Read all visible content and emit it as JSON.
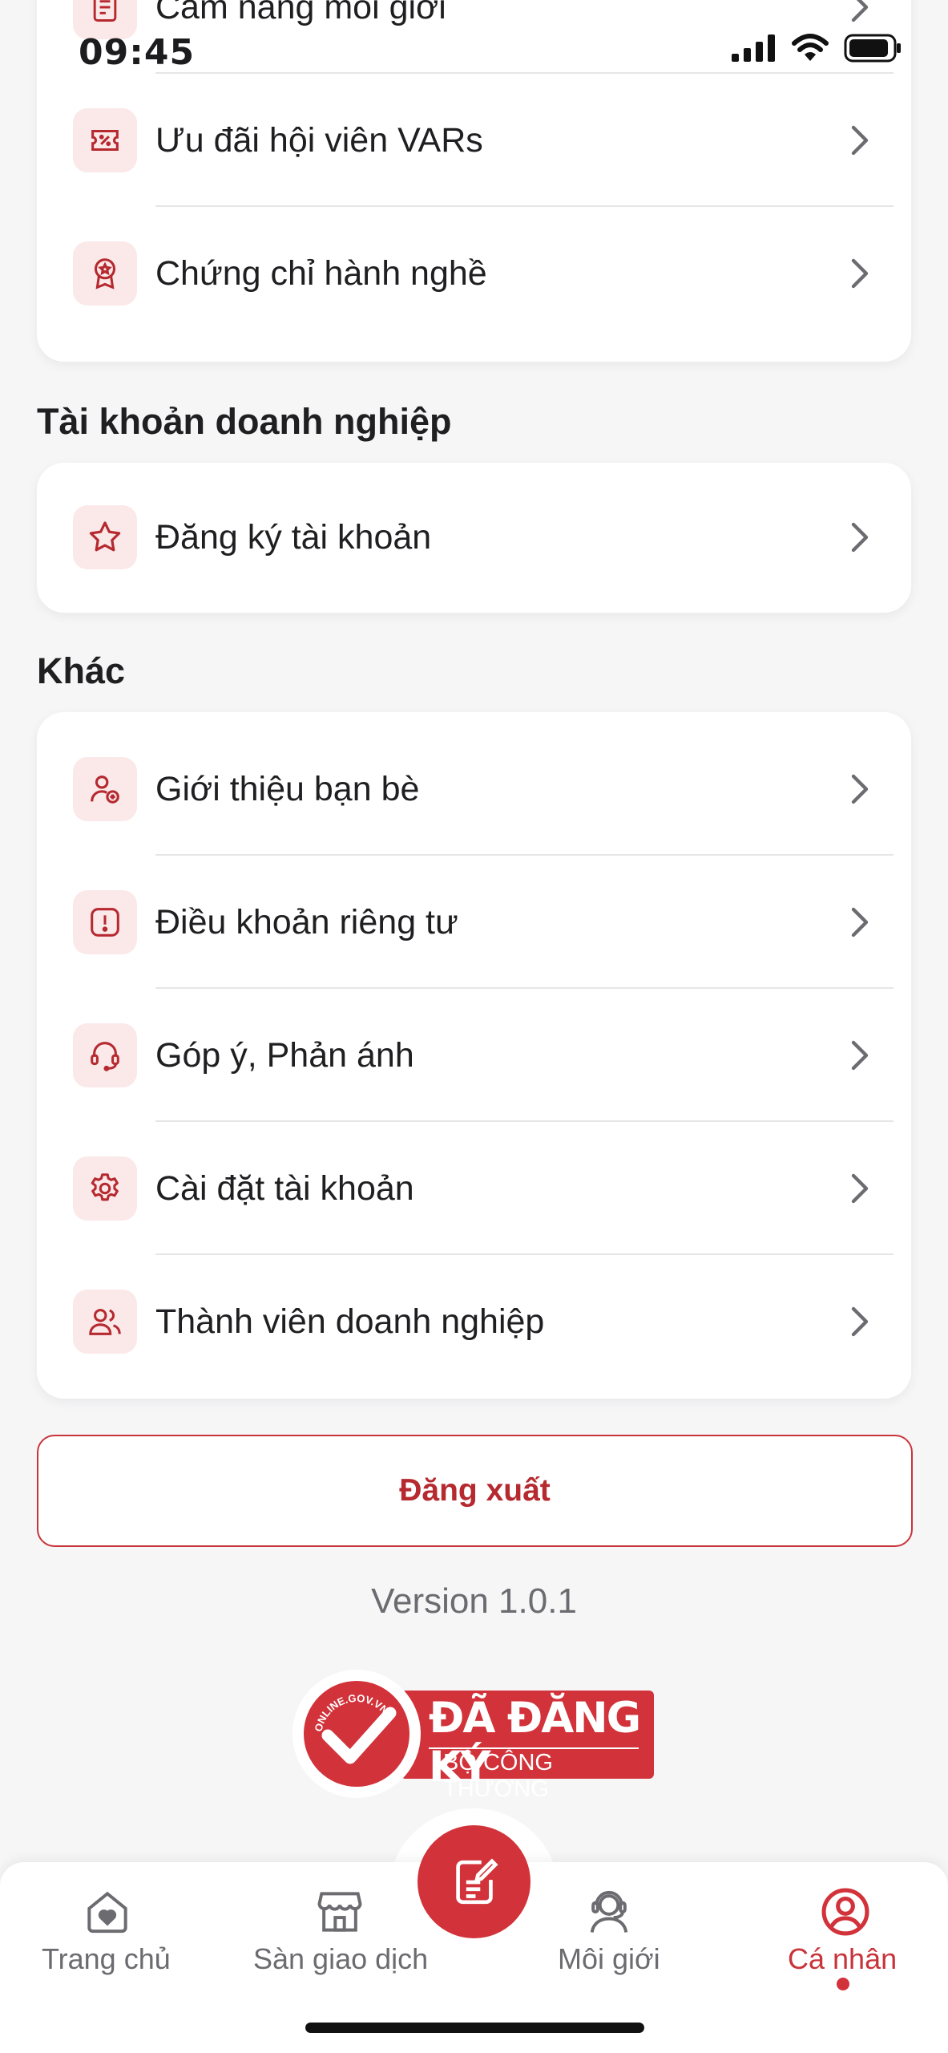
{
  "status_bar": {
    "time": "09:45"
  },
  "top_card": {
    "items": [
      {
        "label": "Cẩm nang môi giới",
        "icon": "document-icon"
      },
      {
        "label": "Ưu đãi hội viên VARs",
        "icon": "discount-ticket-icon"
      },
      {
        "label": "Chứng chỉ hành nghề",
        "icon": "certificate-badge-icon"
      }
    ]
  },
  "business_section": {
    "title": "Tài khoản doanh nghiệp",
    "items": [
      {
        "label": "Đăng ký tài khoản",
        "icon": "star-icon"
      }
    ]
  },
  "other_section": {
    "title": "Khác",
    "items": [
      {
        "label": "Giới thiệu bạn bè",
        "icon": "user-add-icon"
      },
      {
        "label": "Điều khoản riêng tư",
        "icon": "alert-icon"
      },
      {
        "label": "Góp ý, Phản ánh",
        "icon": "headset-icon"
      },
      {
        "label": "Cài đặt tài khoản",
        "icon": "gear-icon"
      },
      {
        "label": "Thành viên doanh nghiệp",
        "icon": "users-icon"
      }
    ]
  },
  "logout_label": "Đăng xuất",
  "version": "Version 1.0.1",
  "badge": {
    "arc_text": "ONLINE.GOV.VN",
    "line1": "ĐÃ ĐĂNG KÝ",
    "line2": "BỘ CÔNG THƯƠNG"
  },
  "tabs": [
    {
      "label": "Trang chủ",
      "icon": "home-heart-icon",
      "active": false
    },
    {
      "label": "Sàn giao dịch",
      "icon": "store-icon",
      "active": false
    },
    {
      "label": "Môi giới",
      "icon": "agent-icon",
      "active": false
    },
    {
      "label": "Cá nhân",
      "icon": "profile-icon",
      "active": true
    }
  ],
  "colors": {
    "accent": "#d2323a",
    "icon_bg": "#fbe9ea",
    "background": "#f6f6f7"
  }
}
